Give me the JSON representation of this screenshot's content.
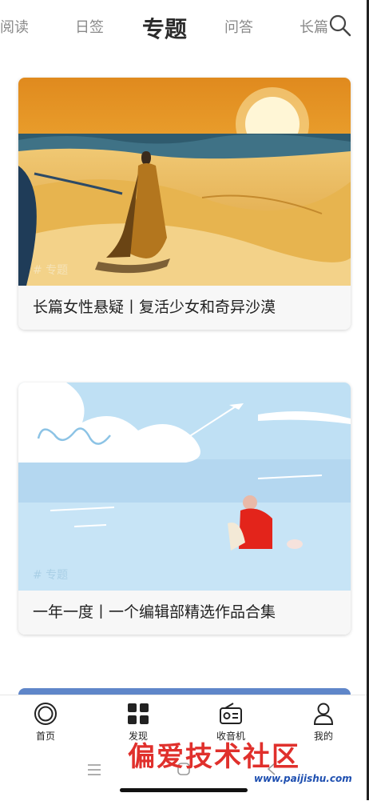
{
  "tabs": [
    {
      "label": "阅读"
    },
    {
      "label": "日签"
    },
    {
      "label": "专题",
      "active": true
    },
    {
      "label": "问答"
    },
    {
      "label": "长篇"
    }
  ],
  "cards": [
    {
      "tag": "# 专题",
      "title": "长篇女性悬疑丨复活少女和奇异沙漠"
    },
    {
      "tag": "# 专题",
      "title": "一年一度丨一个编辑部精选作品合集"
    }
  ],
  "bottom_nav": [
    {
      "label": "首页",
      "icon": "home-icon"
    },
    {
      "label": "发现",
      "icon": "grid-icon"
    },
    {
      "label": "收音机",
      "icon": "radio-icon"
    },
    {
      "label": "我的",
      "icon": "user-icon"
    }
  ],
  "watermark": {
    "text": "偏爱技术社区",
    "url": "www.paijishu.com"
  }
}
